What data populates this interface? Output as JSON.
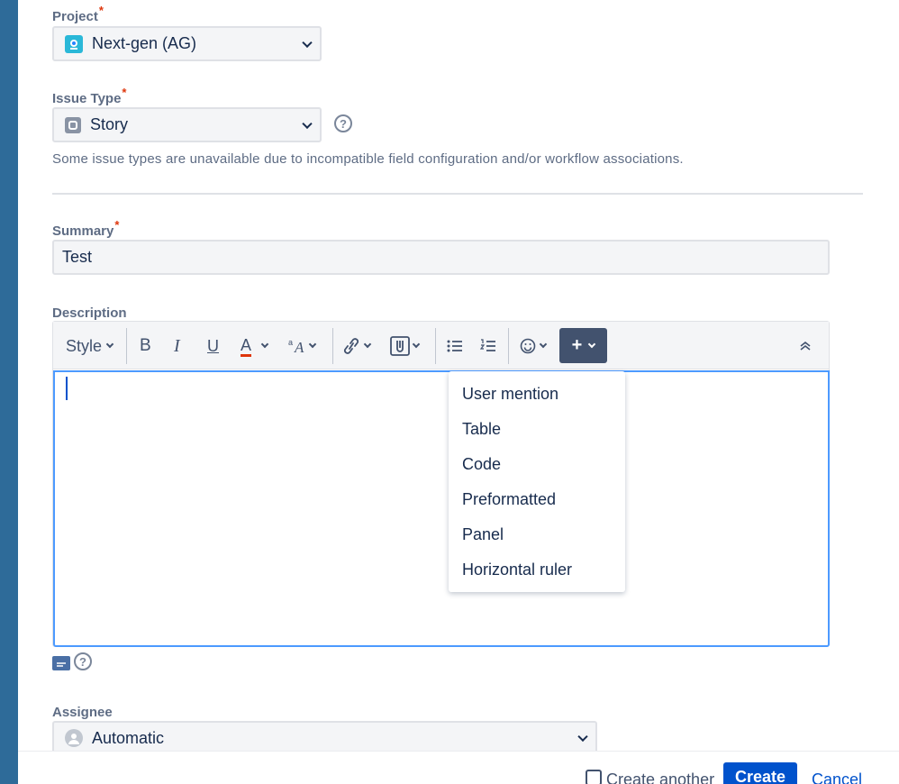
{
  "project": {
    "label": "Project",
    "value": "Next-gen (AG)"
  },
  "issue_type": {
    "label": "Issue Type",
    "value": "Story",
    "help": "?",
    "hint": "Some issue types are unavailable due to incompatible field configuration and/or workflow associations."
  },
  "summary": {
    "label": "Summary",
    "value": "Test"
  },
  "description": {
    "label": "Description",
    "toolbar": {
      "style": "Style",
      "bold": "B",
      "italic": "I",
      "underline": "U",
      "text_color": "A",
      "plus": "+"
    },
    "insert_menu": [
      "User mention",
      "Table",
      "Code",
      "Preformatted",
      "Panel",
      "Horizontal ruler"
    ],
    "help": "?"
  },
  "assignee": {
    "label": "Assignee",
    "value": "Automatic"
  },
  "footer": {
    "create_another": "Create another",
    "create": "Create",
    "cancel": "Cancel"
  },
  "colors": {
    "accent": "#0052cc",
    "focus": "#4c9aff",
    "required": "#de350b",
    "sidebar": "#2e6b99"
  }
}
